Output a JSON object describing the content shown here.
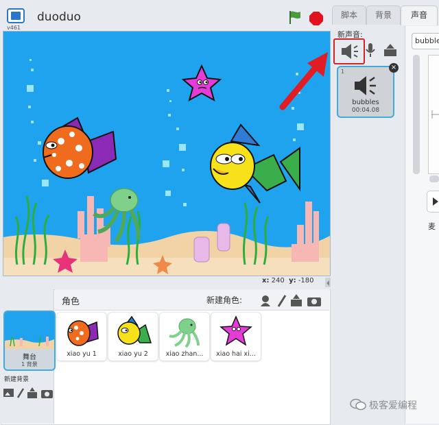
{
  "header": {
    "title": "duoduo",
    "version": "v461",
    "colors": {
      "flag": "#4a9a3e",
      "stop": "#e1121e"
    }
  },
  "stage": {
    "background_color": "#1fa3ef",
    "sand_color": "#f2d3a6",
    "x_label": "x:",
    "x_value": "240",
    "y_label": "y:",
    "y_value": "-180"
  },
  "sprite_pane": {
    "label": "角色",
    "new_sprite_label": "新建角色:",
    "stage_thumb": {
      "name": "舞台",
      "count": "1 背景"
    },
    "new_backdrop_label": "新建背景",
    "sprites": [
      {
        "name": "xiao yu 1",
        "icon": "fish-orange-icon"
      },
      {
        "name": "xiao yu 2",
        "icon": "fish-yellow-icon"
      },
      {
        "name": "xiao zhan...",
        "icon": "octopus-icon"
      },
      {
        "name": "xiao hai xi...",
        "icon": "starfish-icon"
      }
    ]
  },
  "tabs": [
    {
      "label": "脚本",
      "active": false
    },
    {
      "label": "背景",
      "active": false
    },
    {
      "label": "声音",
      "active": true
    }
  ],
  "sounds": {
    "new_sound_label": "新声音:",
    "items": [
      {
        "number": "1",
        "name": "bubbles",
        "duration": "00:04.08"
      }
    ],
    "editor": {
      "name_value": "bubble",
      "mic_label": "麦"
    }
  },
  "annotation": {
    "arrow_color": "#e01c24"
  },
  "watermark": {
    "text": "极客爱编程"
  }
}
